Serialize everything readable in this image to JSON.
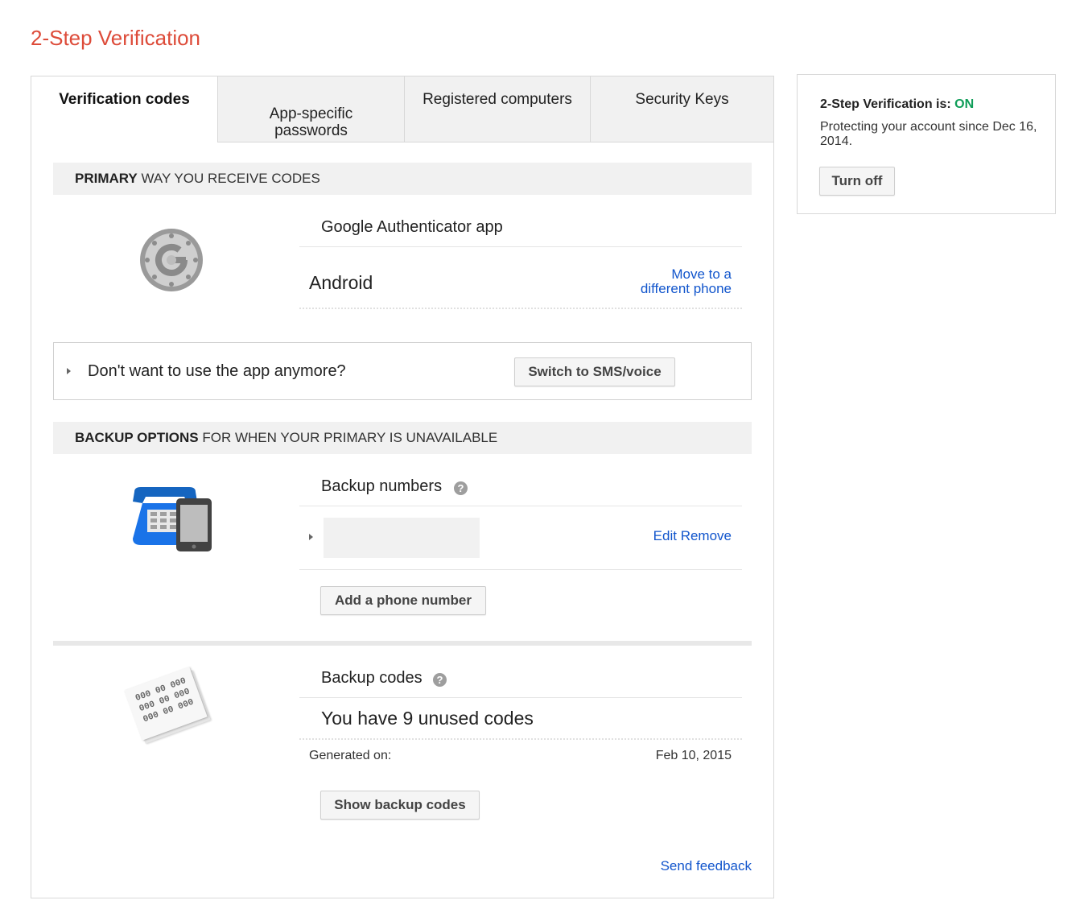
{
  "page_title": "2-Step Verification",
  "tabs": [
    {
      "label": "Verification codes",
      "active": true
    },
    {
      "label": "App-specific passwords",
      "line1": "App-specific",
      "line2": "passwords",
      "active": false
    },
    {
      "label": "Registered computers",
      "active": false
    },
    {
      "label": "Security Keys",
      "active": false
    }
  ],
  "primary": {
    "header_bold": "PRIMARY",
    "header_rest": " WAY YOU RECEIVE CODES",
    "icon": "google-authenticator-icon",
    "app_name": "Google Authenticator app",
    "device": "Android",
    "move_link_line1": "Move to a",
    "move_link_line2": "different phone",
    "switch_prompt": "Don't want to use the app anymore?",
    "switch_button": "Switch to SMS/voice"
  },
  "backup": {
    "header_bold": "BACKUP OPTIONS",
    "header_rest": " FOR WHEN YOUR PRIMARY IS UNAVAILABLE",
    "numbers_title": "Backup numbers",
    "help_glyph": "?",
    "edit_link": "Edit",
    "remove_link": "Remove",
    "add_phone_button": "Add a phone number",
    "codes_title": "Backup codes",
    "unused_codes": "You have 9 unused codes",
    "generated_label": "Generated on:",
    "generated_date": "Feb 10, 2015",
    "show_codes_button": "Show backup codes",
    "code_sheet_text": [
      "000 00 000",
      "000 00 000",
      "000 00 000"
    ]
  },
  "feedback_link": "Send feedback",
  "status": {
    "label": "2-Step Verification is: ",
    "value": "ON",
    "value_color": "#0f9d58",
    "description": "Protecting your account since Dec 16, 2014.",
    "turn_off_button": "Turn off"
  },
  "colors": {
    "title": "#dd4b39",
    "link": "#1155cc",
    "phone_blue": "#1a73e8"
  }
}
